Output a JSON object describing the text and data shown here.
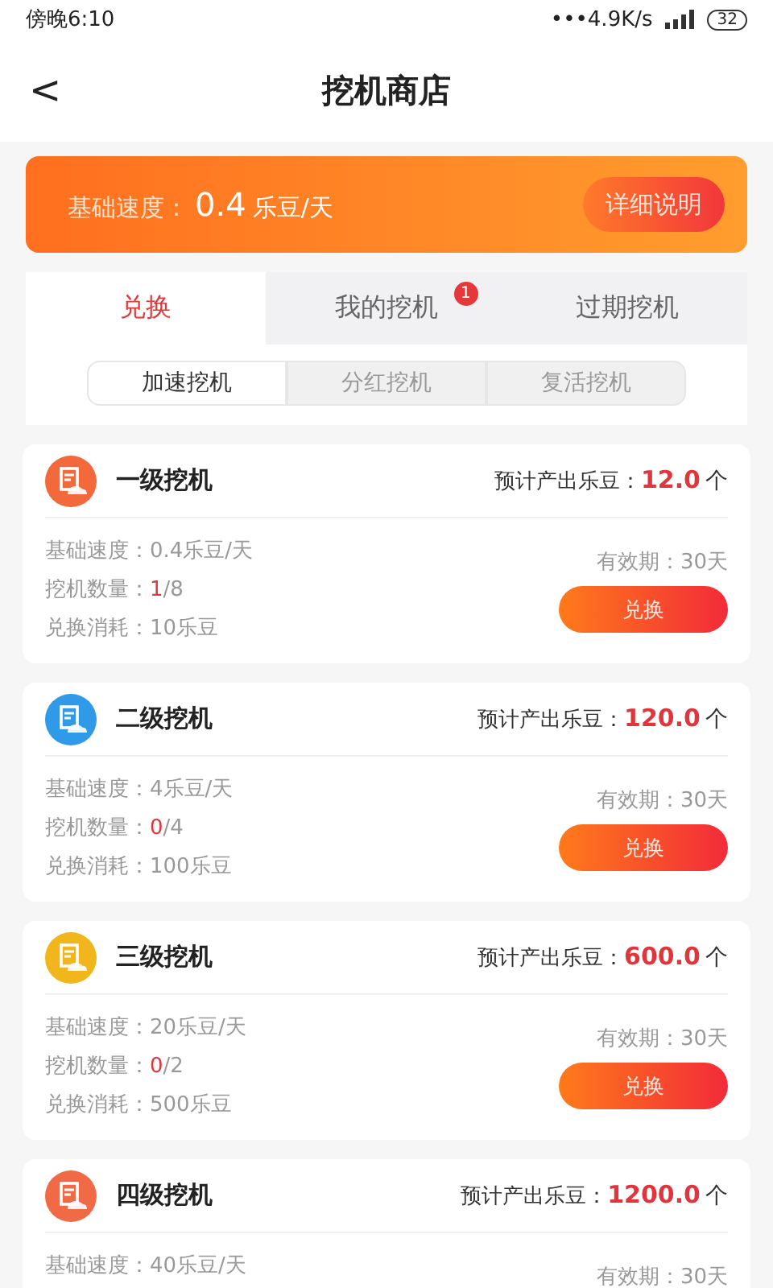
{
  "status_bar": {
    "time": "傍晚6:10",
    "speed": "•••4.9K/s",
    "battery": "32"
  },
  "header": {
    "title": "挖机商店",
    "back": "<"
  },
  "banner": {
    "label": "基础速度：",
    "value": "0.4",
    "unit": "乐豆/天",
    "button": "详细说明"
  },
  "tabs": [
    {
      "label": "兑换",
      "selected": true
    },
    {
      "label": "我的挖机",
      "selected": false,
      "badge": "1"
    },
    {
      "label": "过期挖机",
      "selected": false
    }
  ],
  "subtabs": [
    {
      "label": "加速挖机",
      "selected": true
    },
    {
      "label": "分红挖机",
      "selected": false
    },
    {
      "label": "复活挖机",
      "selected": false
    }
  ],
  "cards": [
    {
      "name": "一级挖机",
      "color": "#f26a3c",
      "output_label": "预计产出乐豆：",
      "output": "12.0",
      "output_unit": "个",
      "speed": "基础速度：0.4乐豆/天",
      "count_label": "挖机数量：",
      "count_owned": "1",
      "count_total": "/8",
      "cost": "兑换消耗：10乐豆",
      "validity": "有效期：30天",
      "button": "兑换"
    },
    {
      "name": "二级挖机",
      "color": "#2f9ae8",
      "output_label": "预计产出乐豆：",
      "output": "120.0",
      "output_unit": "个",
      "speed": "基础速度：4乐豆/天",
      "count_label": "挖机数量：",
      "count_owned": "0",
      "count_total": "/4",
      "cost": "兑换消耗：100乐豆",
      "validity": "有效期：30天",
      "button": "兑换"
    },
    {
      "name": "三级挖机",
      "color": "#f0b61c",
      "output_label": "预计产出乐豆：",
      "output": "600.0",
      "output_unit": "个",
      "speed": "基础速度：20乐豆/天",
      "count_label": "挖机数量：",
      "count_owned": "0",
      "count_total": "/2",
      "cost": "兑换消耗：500乐豆",
      "validity": "有效期：30天",
      "button": "兑换"
    },
    {
      "name": "四级挖机",
      "color": "#f06a45",
      "output_label": "预计产出乐豆：",
      "output": "1200.0",
      "output_unit": "个",
      "speed": "基础速度：40乐豆/天",
      "validity": "有效期：30天"
    }
  ]
}
